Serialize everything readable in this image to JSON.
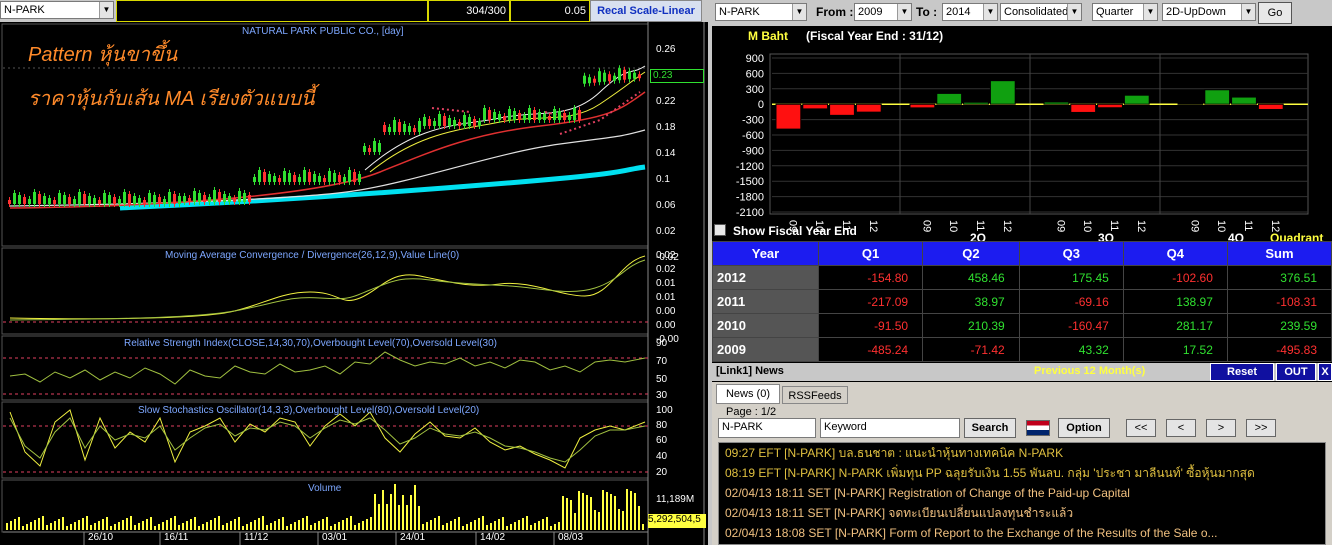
{
  "left_toolbar": {
    "symbol": "N-PARK",
    "counter": "304/300",
    "step": "0.05",
    "recal_label": "Recal Scale-Linear"
  },
  "price_panel": {
    "title": "NATURAL PARK PUBLIC CO., [day]",
    "overlay_line1": "Pattern หุ้นขาขึ้น",
    "overlay_line2": "ราคาหุ้นกับเส้น MA เรียงตัวแบบนี้",
    "current_price": "0.23",
    "y_ticks": [
      "0.26",
      "0.22",
      "0.18",
      "0.14",
      "0.1",
      "0.06",
      "0.02",
      "-0.02"
    ]
  },
  "macd_panel": {
    "title": "Moving Average Convergence / Divergence(26,12,9),Value Line(0)",
    "y_ticks": [
      "0.02",
      "0.02",
      "0.01",
      "0.01",
      "0.00",
      "0.00",
      "-0.00"
    ]
  },
  "rsi_panel": {
    "title": "Relative Strength Index(CLOSE,14,30,70),Overbought Level(70),Oversold Level(30)",
    "y_ticks": [
      "90",
      "70",
      "50",
      "30"
    ]
  },
  "stoch_panel": {
    "title": "Slow Stochastics Oscillator(14,3,3),Overbought Level(80),Oversold Level(20)",
    "y_ticks": [
      "100",
      "80",
      "60",
      "40",
      "20"
    ]
  },
  "volume_panel": {
    "title": "Volume",
    "y_tick": "11,189M",
    "current_volume": "5,292,504,5"
  },
  "date_axis": [
    "26/10",
    "16/11",
    "11/12",
    "03/01",
    "24/01",
    "14/02",
    "08/03"
  ],
  "right_toolbar": {
    "symbol": "N-PARK",
    "from_label": "From :",
    "from_value": "2009",
    "to_label": "To :",
    "to_value": "2014",
    "statement": "Consolidated",
    "period": "Quarter",
    "view": "2D-UpDown",
    "go_label": "Go"
  },
  "fin_chart": {
    "unit_label": "M Baht",
    "fiscal_label": "(Fiscal Year End : 31/12)",
    "show_fiscal_label": "Show Fiscal Year End",
    "y_ticks": [
      "900",
      "600",
      "300",
      "0",
      "-300",
      "-600",
      "-900",
      "-1200",
      "-1500",
      "-1800",
      "-2100"
    ],
    "x_month_labels": [
      "09",
      "10",
      "11",
      "12",
      "09",
      "10",
      "11",
      "12",
      "09",
      "10",
      "11",
      "12",
      "09",
      "10",
      "11",
      "12"
    ],
    "quarter_labels": [
      "2Q",
      "3Q",
      "4Q"
    ],
    "quadrant_label": "Quadrant"
  },
  "chart_data": {
    "type": "bar",
    "ylim": [
      -2100,
      900
    ],
    "ylabel": "M Baht",
    "series": [
      {
        "quarter": "Q1",
        "values": [
          -485.24,
          -91.5,
          -217.09,
          -154.8
        ]
      },
      {
        "quarter": "Q2",
        "values": [
          -71.42,
          210.39,
          38.97,
          458.46
        ]
      },
      {
        "quarter": "Q3",
        "values": [
          43.32,
          -160.47,
          -69.16,
          175.45
        ]
      },
      {
        "quarter": "Q4",
        "values": [
          17.52,
          281.17,
          138.97,
          -102.6
        ]
      }
    ],
    "years": [
      "2009",
      "2010",
      "2011",
      "2012"
    ]
  },
  "fin_table": {
    "headers": [
      "Year",
      "Q1",
      "Q2",
      "Q3",
      "Q4",
      "Sum"
    ],
    "rows": [
      {
        "year": "2012",
        "vals": [
          "-154.80",
          "458.46",
          "175.45",
          "-102.60",
          "376.51"
        ]
      },
      {
        "year": "2011",
        "vals": [
          "-217.09",
          "38.97",
          "-69.16",
          "138.97",
          "-108.31"
        ]
      },
      {
        "year": "2010",
        "vals": [
          "-91.50",
          "210.39",
          "-160.47",
          "281.17",
          "239.59"
        ]
      },
      {
        "year": "2009",
        "vals": [
          "-485.24",
          "-71.42",
          "43.32",
          "17.52",
          "-495.83"
        ]
      }
    ]
  },
  "news": {
    "header_title": "[Link1] News",
    "previous_label": "Previous 12 Month(s)",
    "reset_label": "Reset",
    "out_label": "OUT",
    "close_label": "X",
    "tab_news": "News (0)",
    "tab_rss": "RSSFeeds",
    "page_label": "Page : 1/2",
    "symbol_value": "N-PARK",
    "keyword_placeholder": "Keyword",
    "search_label": "Search",
    "option_label": "Option",
    "first_label": "<<",
    "prev_label": "<",
    "next_label": ">",
    "last_label": ">>",
    "items": [
      "09:27  EFT  [N-PARK]  บล.ธนชาต : แนะนำหุ้นทางเทคนิค N-PARK",
      "08:19  EFT  [N-PARK]  N-PARK เพิ่มทุน PP ฉลุยรับเงิน 1.55 พันลบ. กลุ่ม 'ประชา มาลีนนท์' ซื้อหุ้นมากสุด",
      "02/04/13 18:11  SET  [N-PARK]  Registration of Change of the Paid-up Capital",
      "02/04/13 18:11  SET  [N-PARK]  จดทะเบียนเปลี่ยนแปลงทุนชำระแล้ว",
      "02/04/13 18:08  SET  [N-PARK]  Form of Report to the Exchange of the Results of the Sale o..."
    ]
  },
  "colors": {
    "positive": "#30e030",
    "negative": "#ff3030",
    "header_blue": "#1c1cf0",
    "overlay_text": "#ff8a2a"
  }
}
